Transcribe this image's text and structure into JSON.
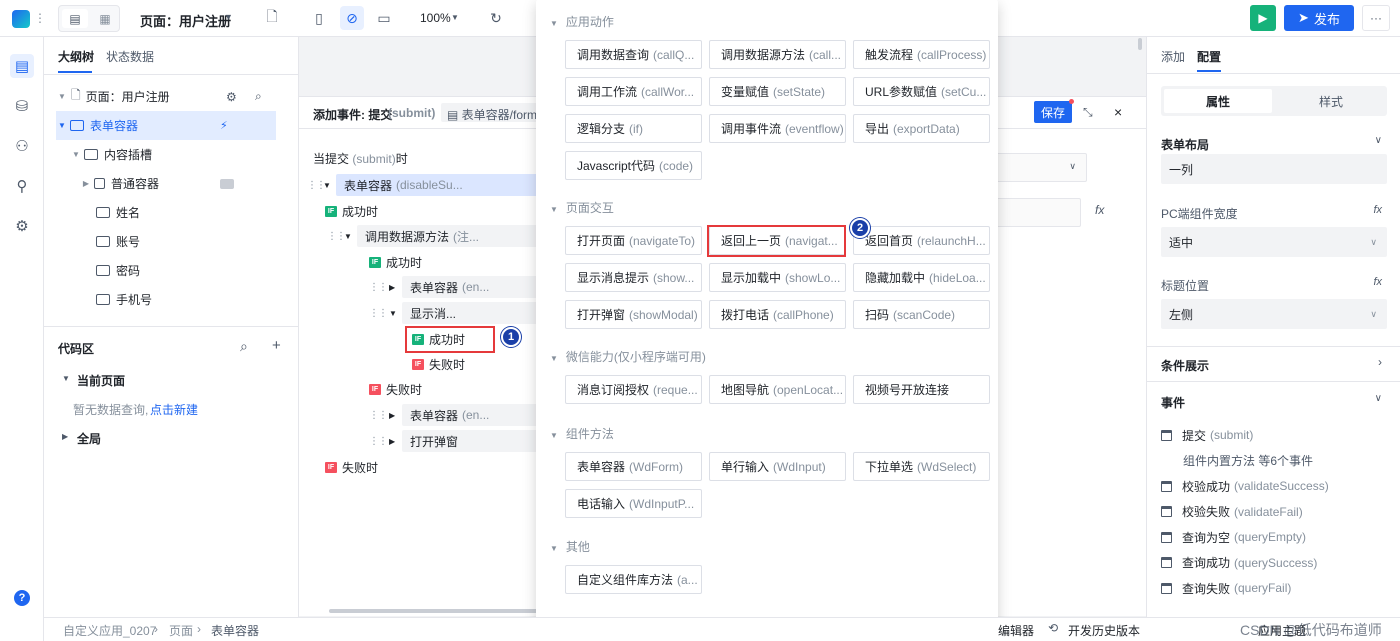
{
  "topbar": {
    "page_title": "页面：用户注册",
    "zoom": "100%",
    "publish_label": "发布"
  },
  "outline": {
    "tabs": [
      "大纲树",
      "状态数据"
    ],
    "tree": [
      {
        "label": "页面：用户注册"
      },
      {
        "label": "表单容器"
      },
      {
        "label": "内容插槽"
      },
      {
        "label": "普通容器"
      },
      {
        "label": "姓名"
      },
      {
        "label": "账号"
      },
      {
        "label": "密码"
      },
      {
        "label": "手机号"
      }
    ]
  },
  "codearea": {
    "title": "代码区",
    "current_page": "当前页面",
    "empty_text": "暂无数据查询,",
    "create_link": "点击新建",
    "global": "全局"
  },
  "event_panel": {
    "header_prefix": "添加事件: 提交",
    "header_en": "(submit)",
    "header_target": "表单容器/form1",
    "save_label": "保存",
    "trigger_label": "当提交",
    "trigger_en": "(submit)",
    "trigger_suffix": "时",
    "nodes": {
      "n1": "表单容器",
      "n1_en": "(disableSu...",
      "success1": "成功时",
      "call_ds": "调用数据源方法",
      "call_ds_en": "(注...",
      "success2": "成功时",
      "form_en": "表单容器",
      "form_en_en": "(en...",
      "show_msg": "显示消...",
      "success3": "成功时",
      "fail3": "失败时",
      "fail2": "失败时",
      "form_en2": "表单容器",
      "form_en2_en": "(en...",
      "open_modal": "打开弹窗",
      "fail1": "失败时"
    }
  },
  "popup": {
    "sections": [
      {
        "title": "应用动作",
        "actions": [
          {
            "cn": "调用数据查询",
            "en": "(callQ..."
          },
          {
            "cn": "调用数据源方法",
            "en": "(call..."
          },
          {
            "cn": "触发流程",
            "en": "(callProcess)"
          },
          {
            "cn": "调用工作流",
            "en": "(callWor..."
          },
          {
            "cn": "变量赋值",
            "en": "(setState)"
          },
          {
            "cn": "URL参数赋值",
            "en": "(setCu..."
          },
          {
            "cn": "逻辑分支",
            "en": "(if)"
          },
          {
            "cn": "调用事件流",
            "en": "(eventflow)"
          },
          {
            "cn": "导出",
            "en": "(exportData)"
          },
          {
            "cn": "Javascript代码",
            "en": "(code)"
          }
        ]
      },
      {
        "title": "页面交互",
        "actions": [
          {
            "cn": "打开页面",
            "en": "(navigateTo)"
          },
          {
            "cn": "返回上一页",
            "en": "(navigat..."
          },
          {
            "cn": "返回首页",
            "en": "(relaunchH..."
          },
          {
            "cn": "显示消息提示",
            "en": "(show..."
          },
          {
            "cn": "显示加载中",
            "en": "(showLo..."
          },
          {
            "cn": "隐藏加载中",
            "en": "(hideLoa..."
          },
          {
            "cn": "打开弹窗",
            "en": "(showModal)"
          },
          {
            "cn": "拨打电话",
            "en": "(callPhone)"
          },
          {
            "cn": "扫码",
            "en": "(scanCode)"
          }
        ]
      },
      {
        "title": "微信能力(仅小程序端可用)",
        "actions": [
          {
            "cn": "消息订阅授权",
            "en": "(reque..."
          },
          {
            "cn": "地图导航",
            "en": "(openLocat..."
          },
          {
            "cn": "视频号开放连接",
            "en": ""
          }
        ]
      },
      {
        "title": "组件方法",
        "actions": [
          {
            "cn": "表单容器",
            "en": "(WdForm)"
          },
          {
            "cn": "单行输入",
            "en": "(WdInput)"
          },
          {
            "cn": "下拉单选",
            "en": "(WdSelect)"
          },
          {
            "cn": "电话输入",
            "en": "(WdInputP..."
          }
        ]
      },
      {
        "title": "其他",
        "actions": [
          {
            "cn": "自定义组件库方法",
            "en": "(a..."
          }
        ]
      }
    ],
    "badge1": "1",
    "badge2": "2"
  },
  "rightpanel": {
    "tabs": [
      "添加",
      "配置"
    ],
    "subtabs": [
      "属性",
      "样式"
    ],
    "form_layout": "表单布局",
    "form_layout_value": "一列",
    "pc_width_label": "PC端组件宽度",
    "pc_width_value": "适中",
    "title_pos_label": "标题位置",
    "title_pos_value": "左侧",
    "cond_display": "条件展示",
    "events_title": "事件",
    "fx": "fx",
    "events": [
      {
        "cn": "提交",
        "en": "(submit)"
      },
      {
        "cn": "组件内置方法 等6个事件",
        "en": ""
      },
      {
        "cn": "校验成功",
        "en": "(validateSuccess)"
      },
      {
        "cn": "校验失败",
        "en": "(validateFail)"
      },
      {
        "cn": "查询为空",
        "en": "(queryEmpty)"
      },
      {
        "cn": "查询成功",
        "en": "(querySuccess)"
      },
      {
        "cn": "查询失败",
        "en": "(queryFail)"
      }
    ]
  },
  "breadcrumb": [
    "自定义应用_0207",
    "页面",
    "表单容器"
  ],
  "footer": {
    "editor": "编辑器",
    "history": "开发历史版本",
    "right": "应用主题",
    "watermark": "CSDN @低代码布道师"
  }
}
